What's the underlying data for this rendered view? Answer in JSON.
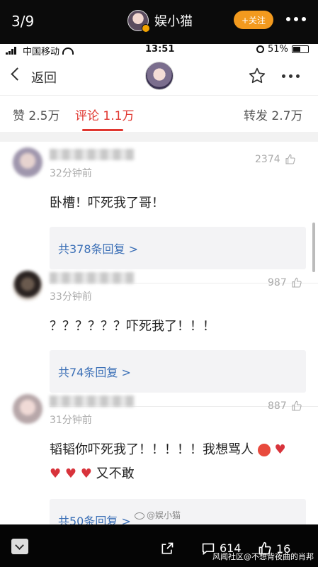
{
  "viewer": {
    "counter": "3/9",
    "author_name": "娱小猫",
    "follow_label": "+关注"
  },
  "status_bar": {
    "carrier": "中国移动",
    "time": "13:51",
    "battery": "51%",
    "battery_level": 0.51
  },
  "nav": {
    "back_label": "返回"
  },
  "tabs": {
    "likes": "赞 2.5万",
    "comments": "评论 1.1万",
    "reposts": "转发 2.7万"
  },
  "comments": [
    {
      "time": "32分钟前",
      "likes": "2374",
      "text": "卧槽！吓死我了哥！",
      "replies": "共378条回复 >"
    },
    {
      "time": "33分钟前",
      "likes": "987",
      "text": "？？？？？？吓死我了！！！",
      "replies": "共74条回复 >"
    },
    {
      "time": "31分钟前",
      "likes": "887",
      "text_line1": "韬韬你吓死我了！！！！！我想骂人",
      "text_line2": "又不敢",
      "replies": "共50条回复 >"
    }
  ],
  "watermark": "@娱小猫",
  "bottom_bar": {
    "comments_count": "614",
    "likes_count": "16",
    "credit": "风闻社区@不想背夜曲的肖邦"
  },
  "colors": {
    "accent_red": "#e0362f",
    "link_blue": "#3b6fb6",
    "follow_orange": "#f39a1e"
  }
}
